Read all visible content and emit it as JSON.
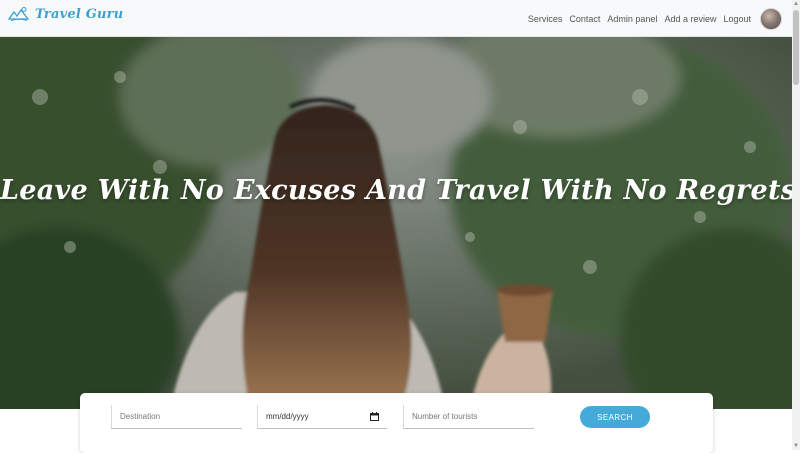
{
  "navbar": {
    "brand": "Travel Guru",
    "links": [
      "Services",
      "Contact",
      "Admin panel",
      "Add a review",
      "Logout"
    ],
    "brand_color": "#3ca0d0"
  },
  "hero": {
    "title": "Leave With No Excuses And Travel With No Regrets"
  },
  "search": {
    "destination_placeholder": "Destination",
    "date_value": "mm/dd/yyyy",
    "tourists_placeholder": "Number of tourists",
    "button_label": "SEARCH",
    "button_color": "#45aad8"
  },
  "icons": {
    "brand": "mountain-cloud-icon",
    "date": "calendar-icon"
  }
}
